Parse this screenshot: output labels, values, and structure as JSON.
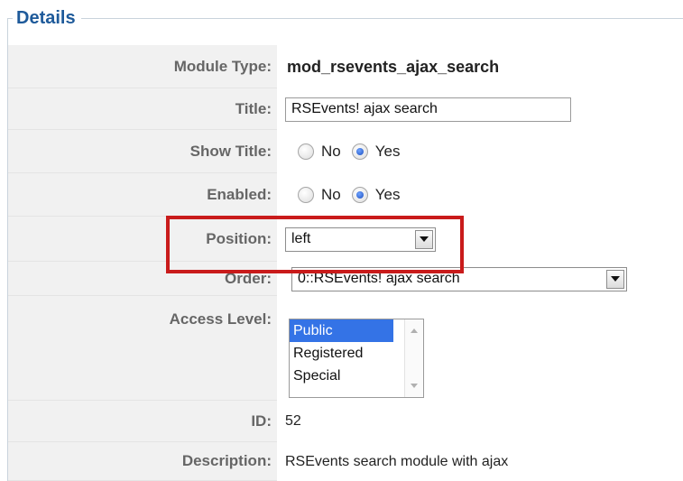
{
  "legend": "Details",
  "fields": {
    "module_type": {
      "label": "Module Type:",
      "value": "mod_rsevents_ajax_search"
    },
    "title": {
      "label": "Title:",
      "value": "RSEvents! ajax search"
    },
    "show_title": {
      "label": "Show Title:",
      "options": [
        "No",
        "Yes"
      ],
      "selected": "Yes"
    },
    "enabled": {
      "label": "Enabled:",
      "options": [
        "No",
        "Yes"
      ],
      "selected": "Yes"
    },
    "position": {
      "label": "Position:",
      "value": "left"
    },
    "order": {
      "label": "Order:",
      "value": "0::RSEvents! ajax search"
    },
    "access_level": {
      "label": "Access Level:",
      "options": [
        "Public",
        "Registered",
        "Special"
      ],
      "selected": "Public"
    },
    "id": {
      "label": "ID:",
      "value": "52"
    },
    "description": {
      "label": "Description:",
      "value": "RSEvents search module with ajax"
    }
  },
  "colors": {
    "legend_text": "#1e5a9a",
    "highlight_border": "#c91b1b",
    "selected_option_bg": "#3473e6"
  }
}
